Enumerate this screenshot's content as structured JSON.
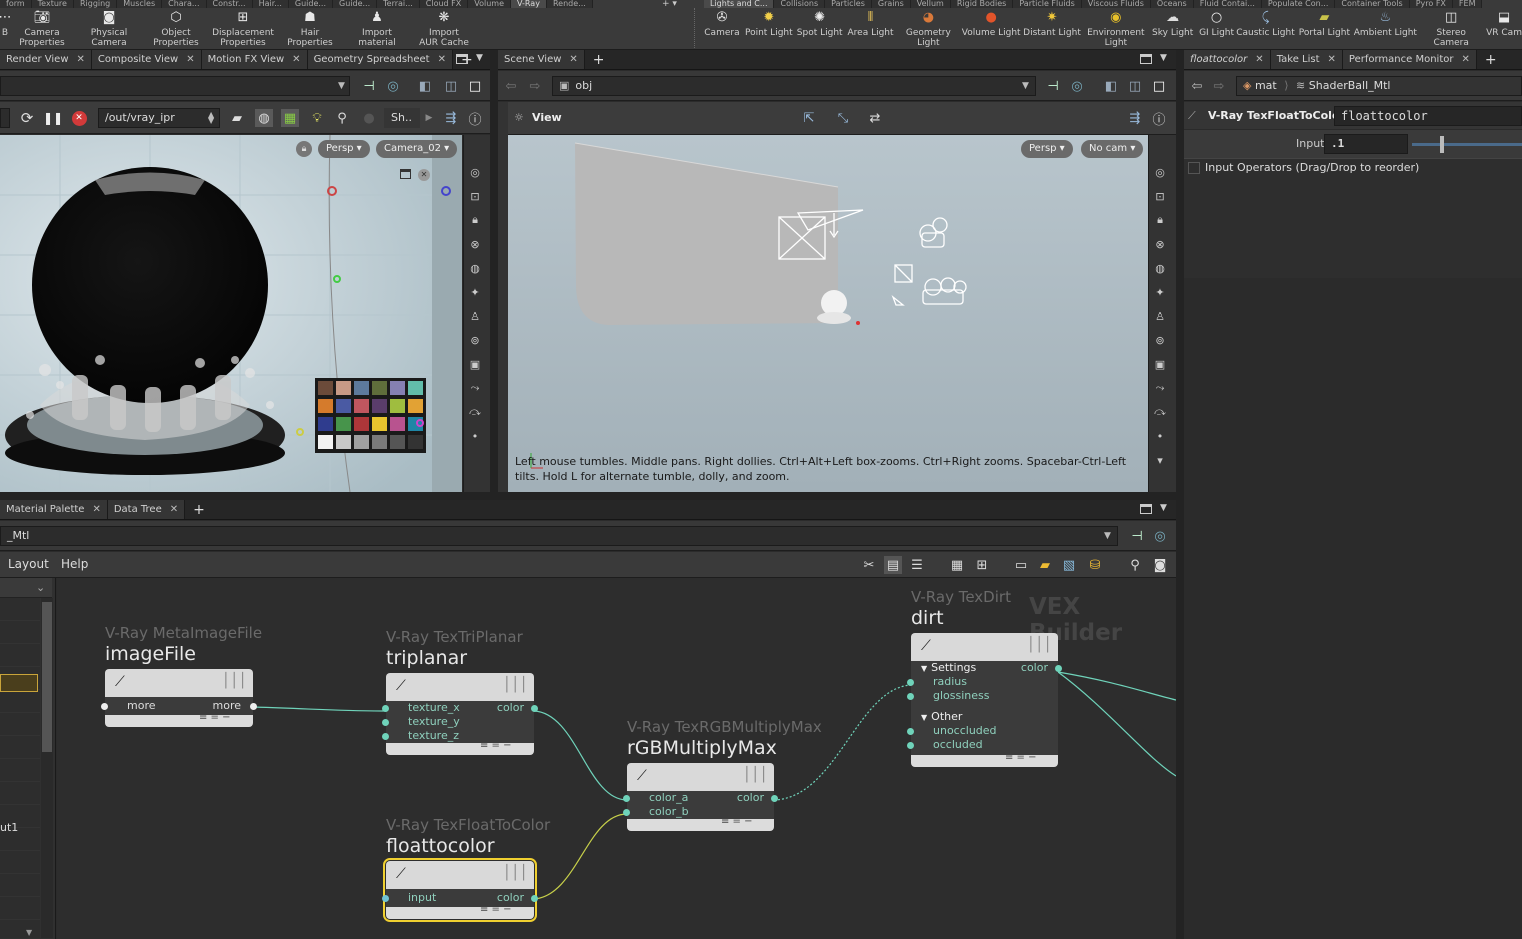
{
  "shelf": {
    "left_tabs": [
      "form",
      "Texture",
      "Rigging",
      "Muscles",
      "Chara...",
      "Constr...",
      "Hair...",
      "Guide...",
      "Guide...",
      "Terrai...",
      "Cloud FX",
      "Volume",
      "V-Ray",
      "Rende..."
    ],
    "left_active": "V-Ray",
    "right_tabs": [
      "Lights and C...",
      "Collisions",
      "Particles",
      "Grains",
      "Vellum",
      "Rigid Bodies",
      "Particle Fluids",
      "Viscous Fluids",
      "Oceans",
      "Fluid Contai...",
      "Populate Con...",
      "Container Tools",
      "Pyro FX",
      "FEM"
    ],
    "right_active": "Lights and C...",
    "left_tools": [
      {
        "label": "B",
        "icon": "fragment-icon"
      },
      {
        "label": "Camera\nProperties",
        "icon": "camera-properties-icon"
      },
      {
        "label": "Physical\nCamera",
        "icon": "physical-camera-icon"
      },
      {
        "label": "Object\nProperties",
        "icon": "object-properties-icon"
      },
      {
        "label": "Displacement\nProperties",
        "icon": "displacement-icon"
      },
      {
        "label": "Hair\nProperties",
        "icon": "hair-icon"
      },
      {
        "label": "Import\nmaterial",
        "icon": "import-material-icon"
      },
      {
        "label": "Import\nAUR Cache",
        "icon": "aur-cache-icon"
      }
    ],
    "right_tools": [
      {
        "label": "Camera",
        "icon": "camera-icon"
      },
      {
        "label": "Point Light",
        "icon": "point-light-icon"
      },
      {
        "label": "Spot Light",
        "icon": "spot-light-icon"
      },
      {
        "label": "Area Light",
        "icon": "area-light-icon"
      },
      {
        "label": "Geometry\nLight",
        "icon": "geometry-light-icon"
      },
      {
        "label": "Volume Light",
        "icon": "volume-light-icon"
      },
      {
        "label": "Distant Light",
        "icon": "distant-light-icon"
      },
      {
        "label": "Environment\nLight",
        "icon": "environment-light-icon"
      },
      {
        "label": "Sky Light",
        "icon": "sky-light-icon"
      },
      {
        "label": "GI Light",
        "icon": "gi-light-icon"
      },
      {
        "label": "Caustic Light",
        "icon": "caustic-light-icon"
      },
      {
        "label": "Portal Light",
        "icon": "portal-light-icon"
      },
      {
        "label": "Ambient Light",
        "icon": "ambient-light-icon"
      },
      {
        "label": "Stereo\nCamera",
        "icon": "stereo-camera-icon"
      },
      {
        "label": "VR Cam",
        "icon": "vr-camera-icon"
      }
    ]
  },
  "render_pane": {
    "tabs": [
      "Render View",
      "Composite View",
      "Motion FX View",
      "Geometry Spreadsheet"
    ],
    "rop_path": "/out/vray_ipr",
    "sh_label": "Sh..",
    "persp": "Persp",
    "camera": "Camera_02"
  },
  "scene_pane": {
    "tabs": [
      "Scene View"
    ],
    "path": "obj",
    "view_label": "View",
    "persp": "Persp",
    "cam": "No cam",
    "hint": "Left mouse tumbles. Middle pans. Right dollies. Ctrl+Alt+Left box-zooms. Ctrl+Right zooms. Spacebar-Ctrl-Left tilts. Hold L for alternate tumble, dolly, and zoom."
  },
  "param_pane": {
    "tabs": [
      "floattocolor",
      "Take List",
      "Performance Monitor"
    ],
    "path_mat": "mat",
    "path_node": "ShaderBall_Mtl",
    "node_type": "V-Ray TexFloatToColor",
    "node_name": "floattocolor",
    "input_label": "Input",
    "input_value": ".1",
    "operators_label": "Input Operators (Drag/Drop to reorder)"
  },
  "network_pane": {
    "tabs": [
      "Material Palette",
      "Data Tree"
    ],
    "path": "_Mtl",
    "menu": [
      "Layout",
      "Help"
    ],
    "watermark": "VEX Builder",
    "left_list": [
      "ut1"
    ]
  },
  "nodes": [
    {
      "id": "imagefile",
      "type": "V-Ray MetaImageFile",
      "name": "imageFile",
      "inputs": [
        "more"
      ],
      "output": "more"
    },
    {
      "id": "triplanar",
      "type": "V-Ray TexTriPlanar",
      "name": "triplanar",
      "inputs": [
        "texture_x",
        "texture_y",
        "texture_z"
      ],
      "output": "color"
    },
    {
      "id": "floattocolor",
      "type": "V-Ray TexFloatToColor",
      "name": "floattocolor",
      "inputs": [
        "input"
      ],
      "output": "color"
    },
    {
      "id": "rgbmultiply",
      "type": "V-Ray TexRGBMultiplyMax",
      "name": "rGBMultiplyMax",
      "inputs": [
        "color_a",
        "color_b"
      ],
      "output": "color"
    },
    {
      "id": "dirt",
      "type": "V-Ray TexDirt",
      "name": "dirt",
      "sections": [
        {
          "label": "Settings",
          "inputs": [
            "radius",
            "glossiness"
          ]
        },
        {
          "label": "Other",
          "inputs": [
            "unoccluded",
            "occluded"
          ]
        }
      ],
      "output": "color"
    }
  ],
  "colors": {
    "wire": "#6fd3ba",
    "selected": "#f0d030",
    "wire_green": "#7ec060"
  }
}
